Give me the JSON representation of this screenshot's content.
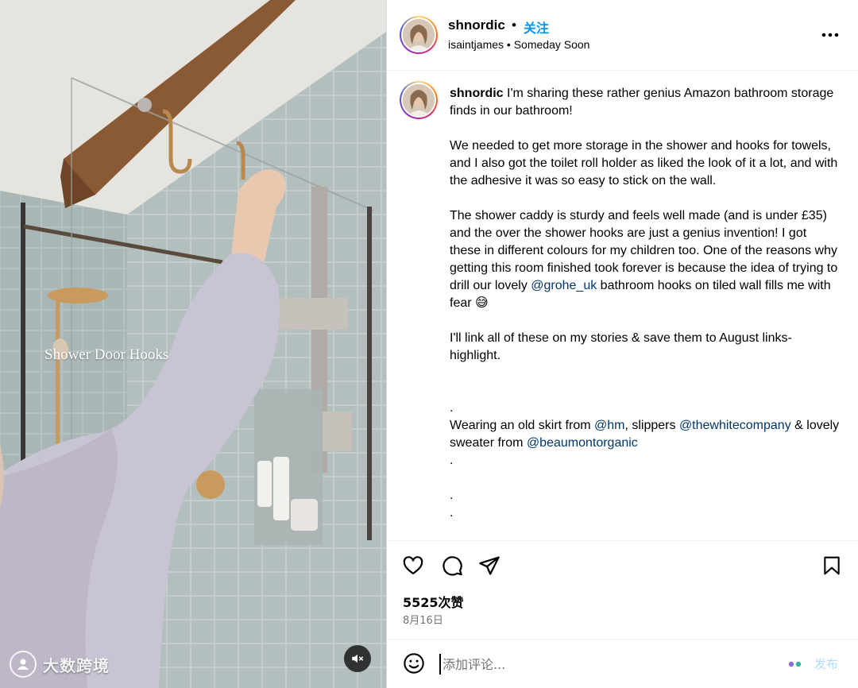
{
  "media": {
    "overlay_text": "Shower Door Hooks",
    "watermark_text": "大数跨境",
    "mute_icon": "speaker-muted-icon"
  },
  "header": {
    "username": "shnordic",
    "separator": "•",
    "follow_label": "关注",
    "subtitle": "isaintjames • Someday Soon",
    "more_icon": "more-horizontal-icon"
  },
  "caption": {
    "username": "shnordic",
    "segments": [
      {
        "type": "text",
        "text": " I'm sharing these rather genius Amazon bathroom storage finds in our bathroom!\n\nWe needed to get more storage in the shower and hooks for towels, and I also got the toilet roll holder as liked the look of it a lot, and with the adhesive it was so easy to stick on the wall.\n\nThe shower caddy is sturdy and feels well made (and is under £35) and the over the shower hooks are just a genius invention! I got these in different colours for my children too. One of the reasons why getting this room finished took forever is because the idea of trying to drill our lovely "
      },
      {
        "type": "mention",
        "text": "@grohe_uk"
      },
      {
        "type": "text",
        "text": " bathroom hooks on tiled wall fills me with fear 😅\n\nI'll link all of these on my stories & save them to August links-highlight.\n\n\n.\nWearing an old skirt from "
      },
      {
        "type": "mention",
        "text": "@hm"
      },
      {
        "type": "text",
        "text": ", slippers "
      },
      {
        "type": "mention",
        "text": "@thewhitecompany"
      },
      {
        "type": "text",
        "text": " & lovely sweater from "
      },
      {
        "type": "mention",
        "text": "@beaumontorganic"
      },
      {
        "type": "text",
        "text": "\n.\n\n.\n.\n\n."
      }
    ]
  },
  "actions": {
    "like_icon": "heart-icon",
    "comment_icon": "comment-icon",
    "share_icon": "paper-plane-icon",
    "save_icon": "bookmark-icon",
    "likes_text": "5525次赞",
    "date_text": "8月16日"
  },
  "comment": {
    "placeholder": "添加评论...",
    "post_label": "发布",
    "emoji_icon": "emoji-icon"
  },
  "colors": {
    "link": "#00376b",
    "follow": "#0095f6",
    "post_disabled": "#b3dbff",
    "secondary_text": "#737373"
  }
}
